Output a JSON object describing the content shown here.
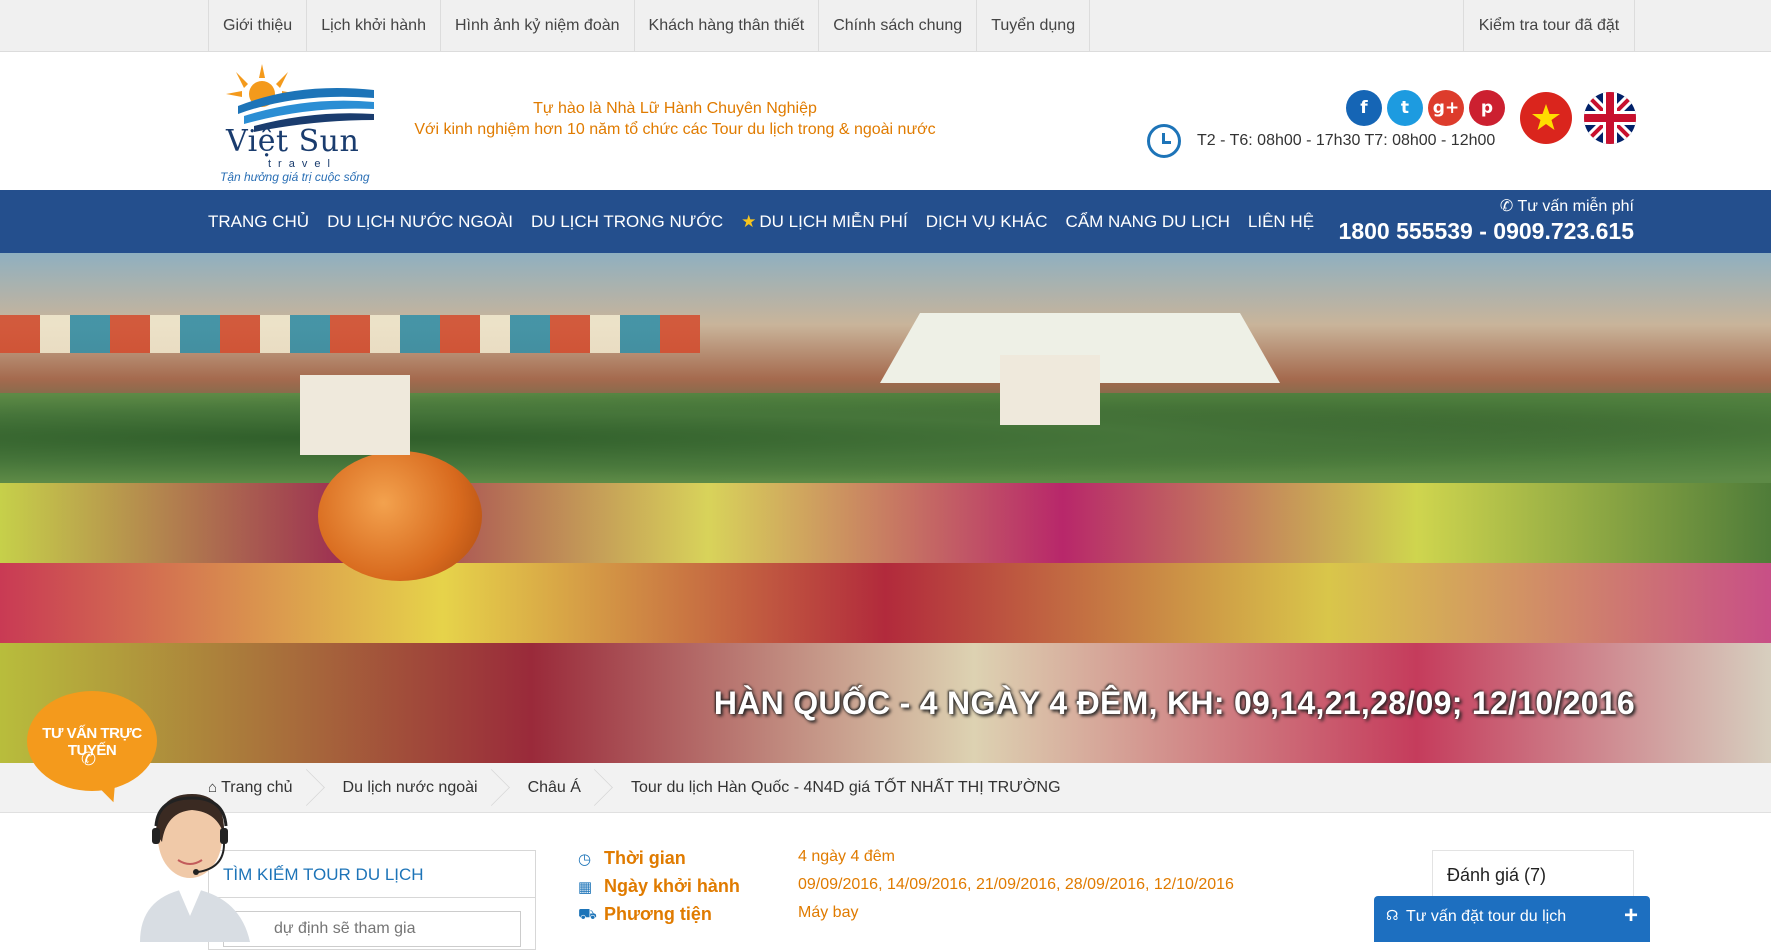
{
  "topbar": {
    "items": [
      "Giới thiệu",
      "Lịch khởi hành",
      "Hình ảnh kỷ niệm đoàn",
      "Khách hàng thân thiết",
      "Chính sách chung",
      "Tuyển dụng"
    ],
    "check_tour": "Kiểm tra tour đã đặt"
  },
  "header": {
    "logo_name": "Việt Sun",
    "logo_sub": "travel",
    "logo_tagline": "Tận hưởng giá trị cuộc sống",
    "slogan_line1": "Tự hào là Nhà Lữ Hành Chuyên Nghiệp",
    "slogan_line2": "Với kinh nghiệm hơn 10 năm tổ chức các Tour du lịch trong & ngoài nước",
    "hours": "T2 - T6: 08h00 - 17h30 T7: 08h00 - 12h00",
    "socials": [
      {
        "icon": "facebook-icon",
        "glyph": "f",
        "color": "#1565b5"
      },
      {
        "icon": "twitter-icon",
        "glyph": "t",
        "color": "#1d9be0"
      },
      {
        "icon": "google-plus-icon",
        "glyph": "g+",
        "color": "#dd3c2c"
      },
      {
        "icon": "pinterest-icon",
        "glyph": "p",
        "color": "#cc2030"
      }
    ]
  },
  "nav": {
    "items": [
      "TRANG CHỦ",
      "DU LỊCH NƯỚC NGOÀI",
      "DU LỊCH TRONG NƯỚC",
      "DU LỊCH MIỄN PHÍ",
      "DỊCH VỤ KHÁC",
      "CẨM NANG DU LỊCH",
      "LIÊN HỆ"
    ],
    "hotline_label": "Tư vấn miễn phí",
    "hotline_number": "1800 555539 - 0909.723.615"
  },
  "banner": {
    "title": "HÀN QUỐC - 4 NGÀY 4 ĐÊM, KH: 09,14,21,28/09; 12/10/2016"
  },
  "breadcrumb": [
    "Trang chủ",
    "Du lịch nước ngoài",
    "Châu Á",
    "Tour du lịch Hàn Quốc - 4N4D giá TỐT NHẤT THỊ TRƯỜNG"
  ],
  "search": {
    "title": "TÌM KIẾM TOUR DU LỊCH",
    "placeholder": "dự định sẽ tham gia"
  },
  "tour_info": [
    {
      "icon": "clock-icon",
      "label": "Thời gian",
      "value": "4 ngày 4 đêm"
    },
    {
      "icon": "calendar-icon",
      "label": "Ngày khởi hành",
      "value": "09/09/2016, 14/09/2016, 21/09/2016, 28/09/2016, 12/10/2016"
    },
    {
      "icon": "car-icon",
      "label": "Phương tiện",
      "value": "Máy bay"
    }
  ],
  "rating": {
    "label": "Đánh giá (7)"
  },
  "chat": {
    "label": "Tư vấn đặt tour du lịch",
    "plus": "+"
  },
  "support": {
    "label": "TƯ VẤN TRỰC TUYẾN"
  },
  "colors": {
    "nav_bg": "#244f8d",
    "accent_orange": "#e07b00",
    "link_blue": "#1d74b8"
  }
}
